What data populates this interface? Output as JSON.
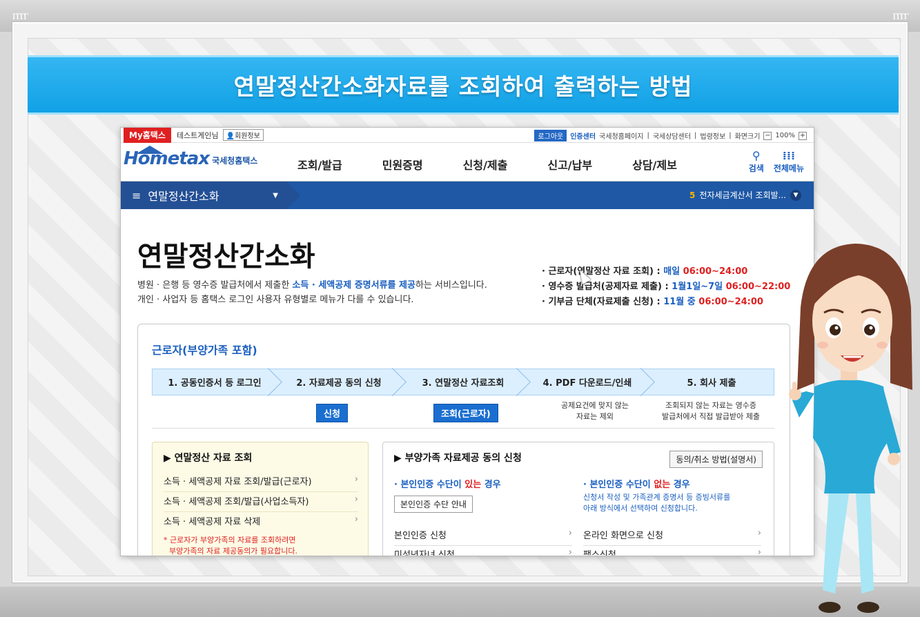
{
  "banner": {
    "title": "연말정산간소화자료를 조회하여 출력하는 방법"
  },
  "frame": {
    "corner_glyph": "ᴦᴦᴦᴦ"
  },
  "topbar": {
    "my_hometax": "My홈택스",
    "user_name": "테스트게인님",
    "member_info": "회원정보",
    "logout": "로그아웃",
    "cert_center": "인증센터",
    "links": [
      "국세청홈페이지",
      "국세상담센터",
      "법령정보",
      "화면크기"
    ],
    "zoom_minus": "−",
    "zoom_level": "100%",
    "zoom_plus": "+"
  },
  "nav": {
    "logo_text": "Hometax",
    "logo_sub": "국세청홈택스",
    "menu": [
      "조회/발급",
      "민원증명",
      "신청/제출",
      "신고/납부",
      "상담/제보"
    ],
    "search_label": "검색",
    "search_icon": "search-icon",
    "all_menu_label": "전체메뉴",
    "all_menu_icon": "grid-icon"
  },
  "subbar": {
    "menu_label": "연말정산간소화",
    "notice_num": "5",
    "notice_text": "전자세금계산서 조회발..."
  },
  "page": {
    "title": "연말정산간소화",
    "desc_line1_pre": "병원 · 은행 등 영수증 발급처에서 제출한 ",
    "desc_line1_hl": "소득 · 세액공제 증명서류를 제공",
    "desc_line1_post": "하는 서비스입니다.",
    "desc_line2": "개인 · 사업자 등 홈택스 로그인 사용자 유형별로 메뉴가 다를 수 있습니다.",
    "schedule": [
      {
        "label": "· 근로자(연말정산 자료 조회) : ",
        "period": "매일",
        "time": "06:00~24:00"
      },
      {
        "label": "· 영수증 발급처(공제자료 제출) : ",
        "period": "1월1일~7일",
        "time": "06:00~22:00"
      },
      {
        "label": "· 기부금 단체(자료제출 신청) : ",
        "period": "11월 중",
        "time": "06:00~24:00"
      }
    ]
  },
  "box": {
    "title": "근로자(부양가족 포함)",
    "steps": [
      "1. 공동인증서 등 로그인",
      "2. 자료제공 동의 신청",
      "3. 연말정산 자료조회",
      "4. PDF 다운로드/인쇄",
      "5. 회사 제출"
    ],
    "apply_btn": "신청",
    "inquiry_btn": "조회(근로자)",
    "note4": [
      "공제요건에 맞지 않는",
      "자료는 제외"
    ],
    "note5": [
      "조회되지 않는 자료는 영수증",
      "발급처에서 직접 발급받아 제출"
    ]
  },
  "panel_left": {
    "title": "▶ 연말정산 자료 조회",
    "items": [
      "소득 · 세액공제 자료 조회/발급(근로자)",
      "소득 · 세액공제 조회/발급(사업소득자)",
      "소득 · 세액공제 자료 삭제"
    ],
    "warning": [
      "* 근로자가 부양가족의 자료를 조회하려면",
      "부양가족의 자료 제공동의가 필요합니다."
    ]
  },
  "panel_right": {
    "title": "▶ 부양가족 자료제공 동의 신청",
    "how_btn": "동의/취소 방법(설명서)",
    "have_head_pre": "· 본인인증 수단이 ",
    "have_head_red": "있는",
    "have_head_post": " 경우",
    "guide_btn": "본인인증 수단 안내",
    "none_head_pre": "· 본인인증 수단이 ",
    "none_head_red": "없는",
    "none_head_post": " 경우",
    "none_note": [
      "신청서 작성 및 가족관계 증명서 등 증빙서류를",
      "아래 방식에서 선택하여 신청합니다."
    ],
    "left_items": [
      "본인인증 신청",
      "미성년자녀 신청"
    ],
    "right_items": [
      "온라인 화면으로 신청",
      "팩스신청"
    ]
  }
}
